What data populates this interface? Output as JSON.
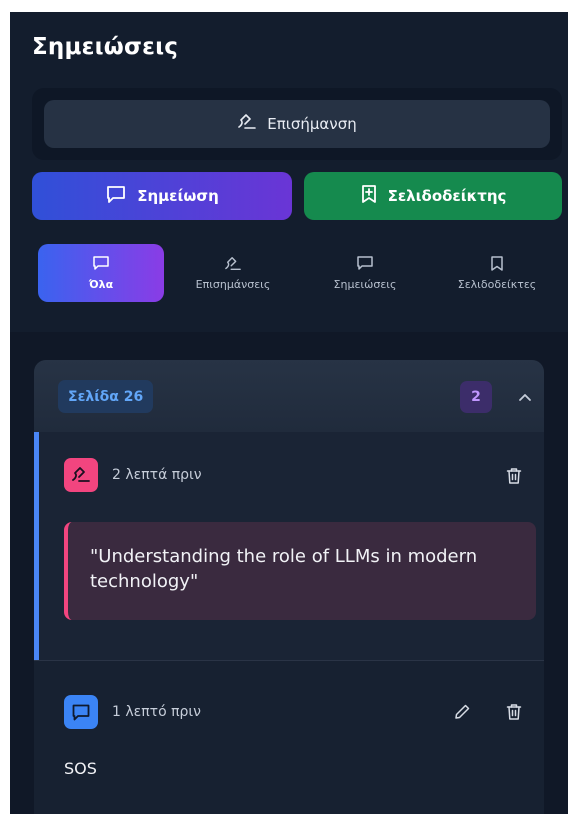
{
  "header": {
    "title": "Σημειώσεις"
  },
  "highlight_button": {
    "label": "Επισήμανση",
    "icon": "highlighter-icon"
  },
  "actions": {
    "note_label": "Σημείωση",
    "note_icon": "message-square-icon",
    "bookmark_label": "Σελιδοδείκτης",
    "bookmark_icon": "bookmark-plus-icon"
  },
  "tabs": [
    {
      "label": "Όλα",
      "icon": "message-square-icon",
      "active": true
    },
    {
      "label": "Επισημάνσεις",
      "icon": "highlighter-icon",
      "active": false
    },
    {
      "label": "Σημειώσεις",
      "icon": "message-square-icon",
      "active": false
    },
    {
      "label": "Σελιδοδείκτες",
      "icon": "bookmark-icon",
      "active": false
    }
  ],
  "group": {
    "page_label": "Σελίδα 26",
    "count": "2",
    "items": [
      {
        "type": "highlight",
        "icon": "highlighter-icon",
        "time": "2 λεπτά πριν",
        "quote": "\"Understanding the role of LLMs in modern technology\""
      },
      {
        "type": "note",
        "icon": "message-square-icon",
        "time": "1 λεπτό πριν",
        "text": "SOS"
      }
    ]
  },
  "colors": {
    "panel_bg": "#131d2d",
    "accent_blue": "#4a86f6",
    "highlight_pink": "#f2457f",
    "bookmark_green": "#158a4e",
    "count_purple": "#c197ff"
  }
}
